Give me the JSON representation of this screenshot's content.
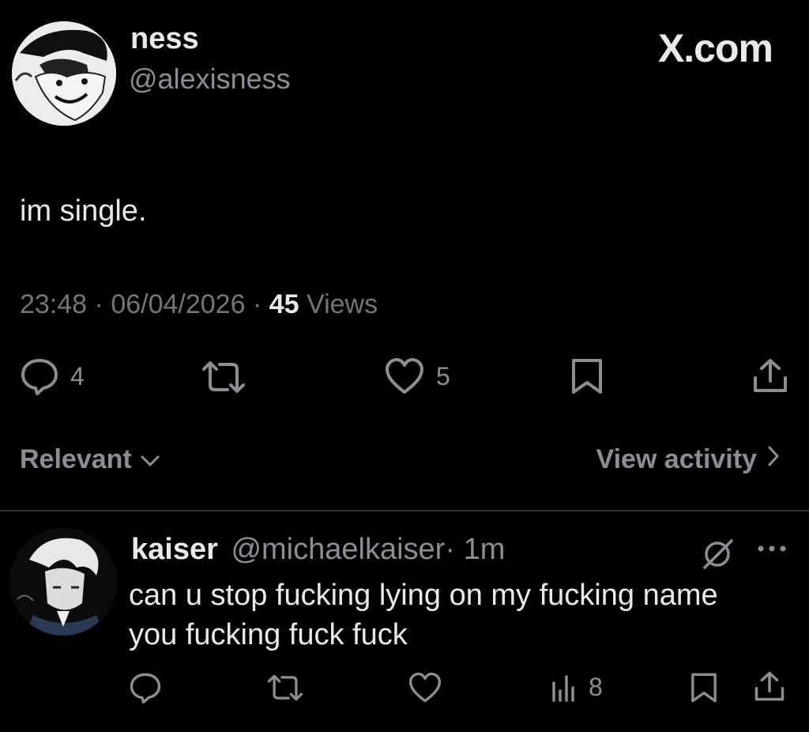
{
  "brand": "X.com",
  "tweet": {
    "display_name": "ness",
    "handle": "@alexisness",
    "text": "im single.",
    "time": "23:48",
    "date": "06/04/2026",
    "views_count": "45",
    "views_label": "Views",
    "reply_count": "4",
    "like_count": "5"
  },
  "replies_bar": {
    "sort_label": "Relevant",
    "activity_label": "View activity"
  },
  "reply": {
    "display_name": "kaiser",
    "handle": "@michaelkaiser",
    "time": "1m",
    "lines": [
      "can u stop fucking lying on my fucking name",
      "you fucking fuck fuck"
    ],
    "views_count": "8"
  },
  "icons": {
    "reply": "speech-bubble-icon",
    "retweet": "retweet-icon",
    "like": "heart-icon",
    "bookmark": "bookmark-icon",
    "share": "share-icon",
    "views": "bar-chart-icon",
    "grok": "grok-icon",
    "more": "more-icon"
  }
}
